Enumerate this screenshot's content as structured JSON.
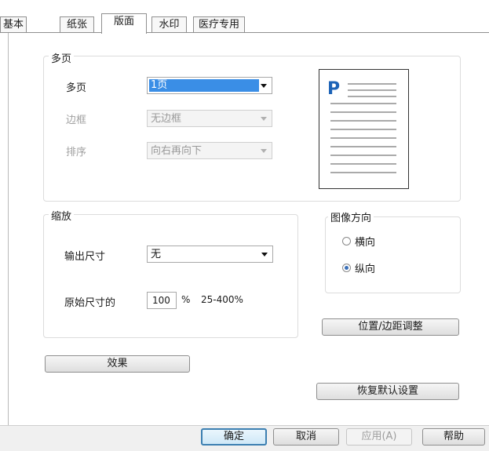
{
  "tabs": [
    "基本",
    "纸张",
    "版面",
    "水印",
    "医疗专用"
  ],
  "multipage": {
    "group_label": "多页",
    "pages_label": "多页",
    "pages_value": "1页",
    "border_label": "边框",
    "border_value": "无边框",
    "order_label": "排序",
    "order_value": "向右再向下"
  },
  "preview": {
    "letter": "P"
  },
  "scaling": {
    "group_label": "缩放",
    "output_size_label": "输出尺寸",
    "output_size_value": "无",
    "original_size_label": "原始尺寸的",
    "percent_value": "100",
    "percent_unit": "%",
    "range": "25-400%"
  },
  "orientation": {
    "group_label": "图像方向",
    "landscape": "横向",
    "portrait": "纵向",
    "selected": "portrait"
  },
  "buttons": {
    "position_margin": "位置/边距调整",
    "effects": "效果",
    "restore_defaults": "恢复默认设置",
    "ok": "确定",
    "cancel": "取消",
    "apply": "应用(A)",
    "help": "帮助"
  },
  "colors": {
    "accent": "#3a8ee6",
    "default_button_border": "#3c7fb1"
  }
}
